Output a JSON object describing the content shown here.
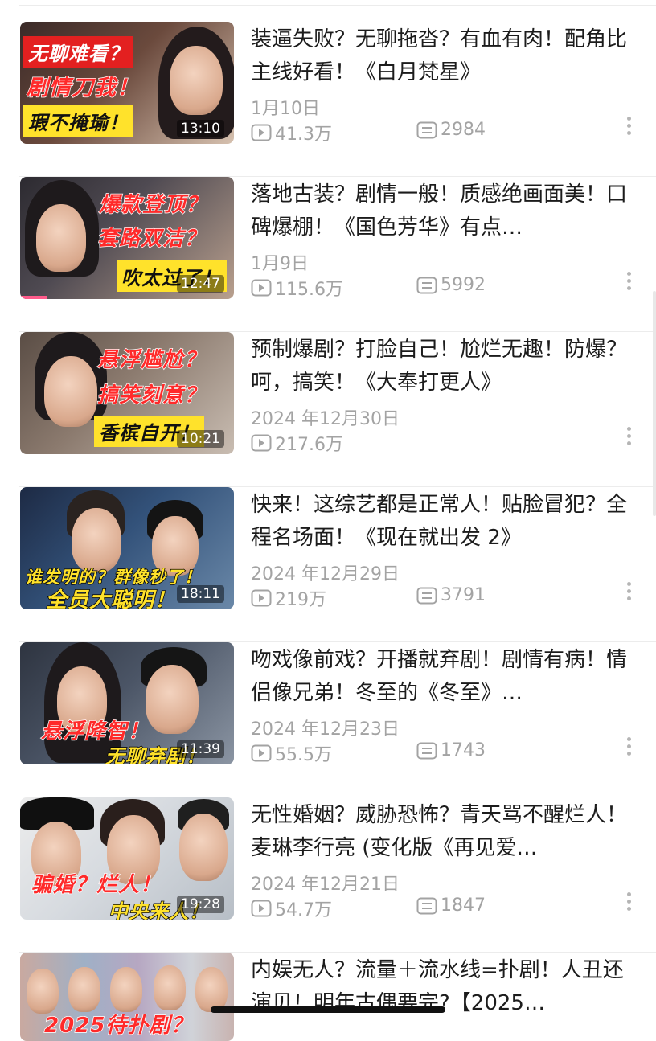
{
  "videos": [
    {
      "title": "装逼失败？无聊拖沓？有血有肉！配角比主线好看！《白月梵星》",
      "date": "1月10日",
      "plays": "41.3万",
      "comments": "2984",
      "duration": "13:10",
      "captions": [
        "无聊难看？",
        "剧情刀我！",
        "瑕不掩瑜！"
      ]
    },
    {
      "title": "落地古装？剧情一般！质感绝画面美！口碑爆棚！《国色芳华》有点…",
      "date": "1月9日",
      "plays": "115.6万",
      "comments": "5992",
      "duration": "12:47",
      "captions": [
        "爆款登顶？",
        "套路双洁？",
        "吹太过了！"
      ]
    },
    {
      "title": "预制爆剧？打脸自己！尬烂无趣！防爆？呵，搞笑！《大奉打更人》",
      "date": "2024 年12月30日",
      "plays": "217.6万",
      "comments": "",
      "duration": "10:21",
      "captions": [
        "悬浮尴尬？",
        "搞笑刻意？",
        "香槟自开！"
      ]
    },
    {
      "title": "快来！这综艺都是正常人！贴脸冒犯？全程名场面！《现在就出发 2》",
      "date": "2024 年12月29日",
      "plays": "219万",
      "comments": "3791",
      "duration": "18:11",
      "captions": [
        "谁发明的？群像秒了！",
        "全员大聪明！"
      ]
    },
    {
      "title": "吻戏像前戏？开播就弃剧！剧情有病！情侣像兄弟！冬至的《冬至》…",
      "date": "2024 年12月23日",
      "plays": "55.5万",
      "comments": "1743",
      "duration": "11:39",
      "captions": [
        "悬浮降智！",
        "无聊弃剧！"
      ]
    },
    {
      "title": "无性婚姻？威胁恐怖？青天骂不醒烂人！麦琳李行亮 (变化版《再见爱…",
      "date": "2024 年12月21日",
      "plays": "54.7万",
      "comments": "1847",
      "duration": "19:28",
      "captions": [
        "骗婚？烂人！",
        "中央来人！"
      ]
    },
    {
      "title": "内娱无人？流量＋流水线=扑剧！人丑还演贝！明年古偶要完?【2025…",
      "date": "",
      "plays": "",
      "comments": "",
      "duration": "",
      "captions": [
        "2025待扑剧？"
      ]
    }
  ],
  "colors": {
    "caption_red": "#ff2a2a",
    "caption_yellow": "#ffe22b",
    "meta_gray": "#a3a3a3",
    "progress_pink": "#ff5b8b"
  },
  "icons": {
    "play": "play-count-icon",
    "comment": "comment-count-icon",
    "more": "more-vertical-icon"
  }
}
